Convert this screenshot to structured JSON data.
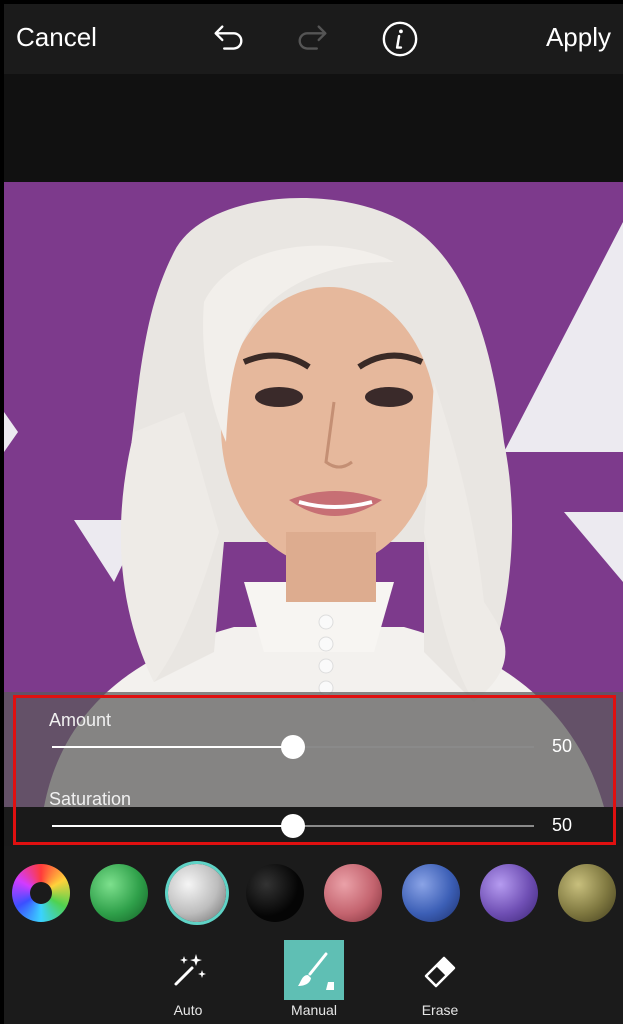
{
  "topbar": {
    "cancel_label": "Cancel",
    "apply_label": "Apply"
  },
  "sliders": [
    {
      "label": "Amount",
      "value": "50",
      "fraction": 0.5
    },
    {
      "label": "Saturation",
      "value": "50",
      "fraction": 0.5
    }
  ],
  "swatches": [
    {
      "name": "color-wheel",
      "color": "conic"
    },
    {
      "name": "green",
      "color": "#2fa04a"
    },
    {
      "name": "silver",
      "color": "#bdbdbd",
      "selected": true
    },
    {
      "name": "black",
      "color": "#050505"
    },
    {
      "name": "pink",
      "color": "#c4646f"
    },
    {
      "name": "blue",
      "color": "#3c5fb6"
    },
    {
      "name": "purple",
      "color": "#6f4fb4"
    },
    {
      "name": "olive",
      "color": "#7f7840"
    }
  ],
  "tools": [
    {
      "label": "Auto",
      "icon": "magic-wand-icon"
    },
    {
      "label": "Manual",
      "icon": "brush-icon",
      "active": true
    },
    {
      "label": "Erase",
      "icon": "eraser-icon"
    }
  ],
  "colors": {
    "accent": "#5fbfb4",
    "highlight_border": "#e01010",
    "background_purple": "#7d3a8c"
  }
}
